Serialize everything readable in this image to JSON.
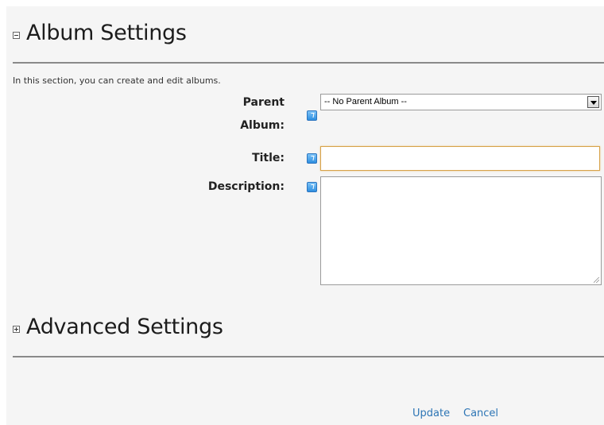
{
  "album_settings": {
    "title": "Album Settings",
    "intro": "In this section, you can create and edit albums."
  },
  "form": {
    "parent_album": {
      "label_line1": "Parent",
      "label_line2": "Album:",
      "selected": "-- No Parent Album --"
    },
    "title": {
      "label": "Title:",
      "value": ""
    },
    "description": {
      "label": "Description:",
      "value": ""
    }
  },
  "advanced_settings": {
    "title": "Advanced Settings"
  },
  "actions": {
    "update": "Update",
    "cancel": "Cancel"
  },
  "icons": {
    "collapse": "minus-box-icon",
    "expand": "plus-box-icon",
    "help": "help-icon"
  }
}
